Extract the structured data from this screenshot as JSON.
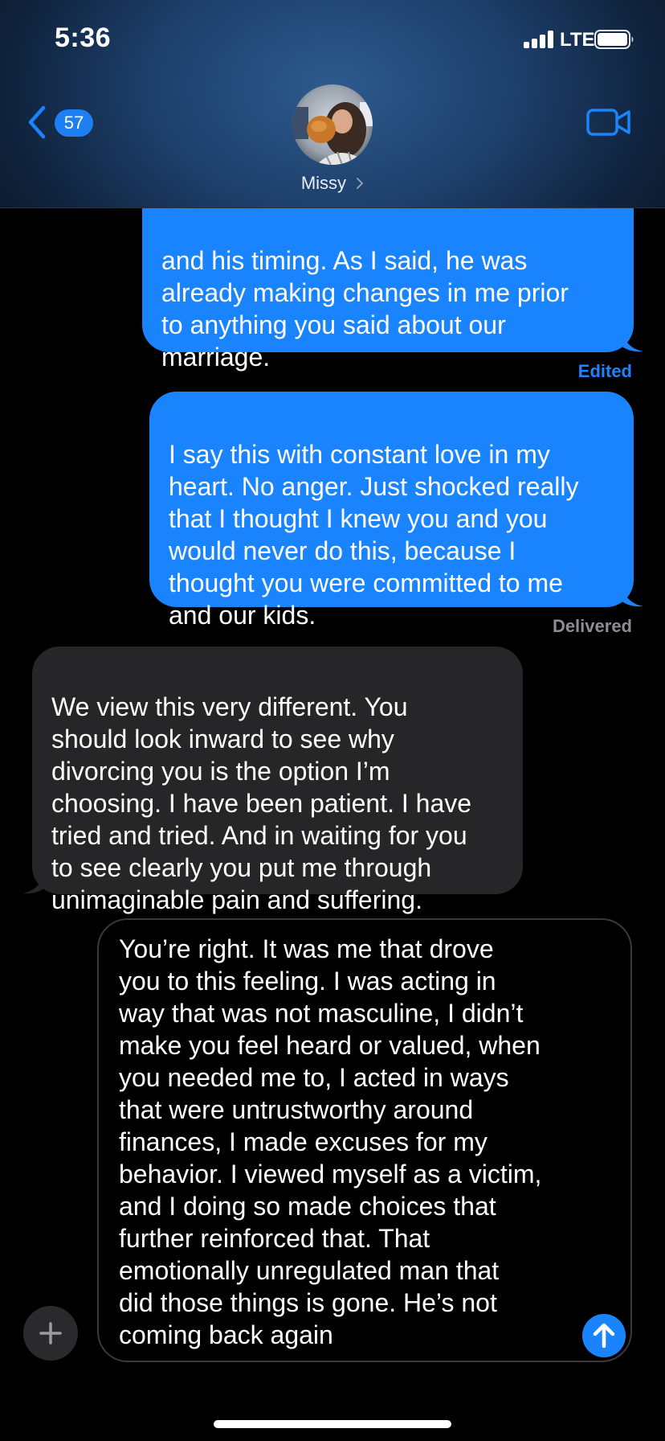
{
  "status_bar": {
    "time": "5:36",
    "network": "LTE",
    "signal_icon": "cellular-signal-icon",
    "battery_icon": "battery-icon"
  },
  "header": {
    "back_icon": "chevron-left-icon",
    "unread_count": "57",
    "contact_name": "Missy",
    "contact_chevron_icon": "chevron-right-icon",
    "video_icon": "video-camera-icon"
  },
  "messages": [
    {
      "direction": "sent",
      "text": "and his timing. As I said, he was\nalready making changes in me prior\nto anything you said about our\nmarriage.",
      "status": "Edited"
    },
    {
      "direction": "sent",
      "text": "I say this with constant love in my\nheart. No anger. Just shocked really\nthat I thought I knew you and you\nwould never do this, because I\nthought you were committed to me\nand our kids.",
      "status": "Delivered"
    },
    {
      "direction": "received",
      "text": "We view this very different. You\nshould look inward to see why\ndivorcing you is the option I’m\nchoosing. I have been patient. I have\ntried and tried. And in waiting for you\nto see clearly you put me through\nunimaginable pain and suffering."
    }
  ],
  "compose": {
    "plus_icon": "plus-icon",
    "send_icon": "send-arrow-up-icon",
    "draft": "You’re right. It was me that drove\nyou to this feeling. I was acting in\nway that was not masculine, I didn’t\nmake you feel heard or valued, when\nyou needed me to, I acted in ways\nthat were untrustworthy around\nfinances, I made excuses for my\nbehavior. I viewed myself as a victim,\nand I doing so made choices that\nfurther reinforced that. That\nemotionally unregulated man that\ndid those things is gone. He’s not\ncoming back again"
  },
  "colors": {
    "sent_bubble": "#1a84ff",
    "received_bubble": "#262628",
    "edited_label": "#1d84ff",
    "delivered_label": "#8d8d93",
    "background": "#000000"
  }
}
